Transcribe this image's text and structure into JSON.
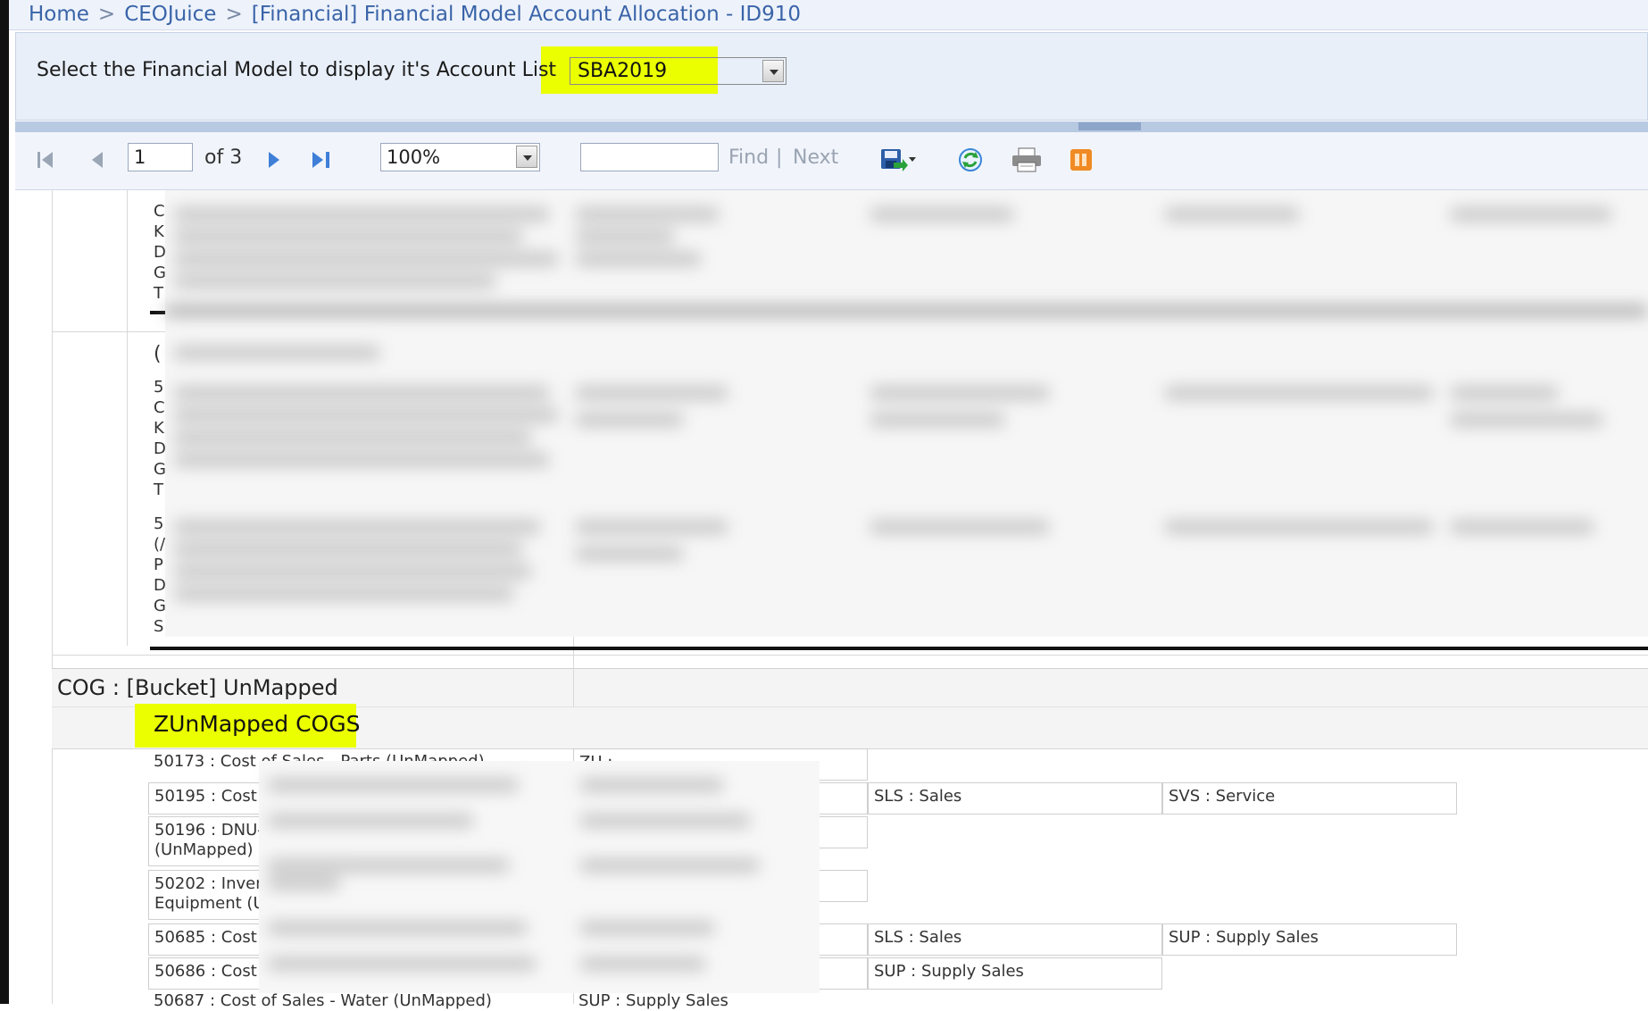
{
  "breadcrumb": {
    "home": "Home",
    "app": "CEOJuice",
    "page": "[Financial] Financial Model Account Allocation - ID910",
    "separator": ">"
  },
  "parameters": {
    "label": "Select the Financial Model to display it's Account List",
    "model_value": "SBA2019"
  },
  "toolbar": {
    "page_number": "1",
    "of_pages": "of 3",
    "zoom": "100%",
    "find_label": "Find",
    "find_separator": "|",
    "next_label": "Next",
    "icons": [
      "first-page-icon",
      "previous-page-icon",
      "next-page-icon",
      "last-page-icon",
      "export-save-icon",
      "refresh-icon",
      "print-icon",
      "data-feed-icon"
    ]
  },
  "report": {
    "bucket_label": "COG : [Bucket] UnMapped",
    "group_label": "ZUnMapped COGS",
    "rows": [
      {
        "account": "50173 : Cost of Sales - Parts (UnMapped)",
        "col2": "ZU : ",
        "col3": "",
        "col4": ""
      },
      {
        "account": "50195 : Cost c",
        "col2": "",
        "col3": "SLS : Sales",
        "col4": "SVS : Service"
      },
      {
        "account": "50196 : DNU-",
        "account2": "(UnMapped)",
        "col2": "",
        "col3": "",
        "col4": ""
      },
      {
        "account": "50202 : Invent",
        "account2": "Equipment (Ur",
        "col2": "",
        "col3": "",
        "col4": ""
      },
      {
        "account": "50685 : Cost c",
        "col2": "",
        "col3": "SLS : Sales",
        "col4": "SUP : Supply Sales"
      },
      {
        "account": "50686 : Cost c",
        "col2": "",
        "col3": "SUP : Supply Sales",
        "col4": ""
      },
      {
        "account": "50687 : Cost of Sales - Water (UnMapped)",
        "col2": "SUP : Supply Sales",
        "col3": "",
        "col4": ""
      }
    ],
    "top_left_letters": [
      "C",
      "K",
      "D",
      "G",
      "T"
    ],
    "mid_left_letters": [
      "(",
      "5",
      "C",
      "K",
      "D",
      "G",
      "T"
    ],
    "lower_left_letters": [
      "5",
      "(/",
      "P",
      "D",
      "G",
      "S"
    ]
  },
  "colors": {
    "highlight": "#ebff00",
    "breadcrumb_link": "#3a64a8",
    "toolbar_bg": "#f1f5fb"
  }
}
